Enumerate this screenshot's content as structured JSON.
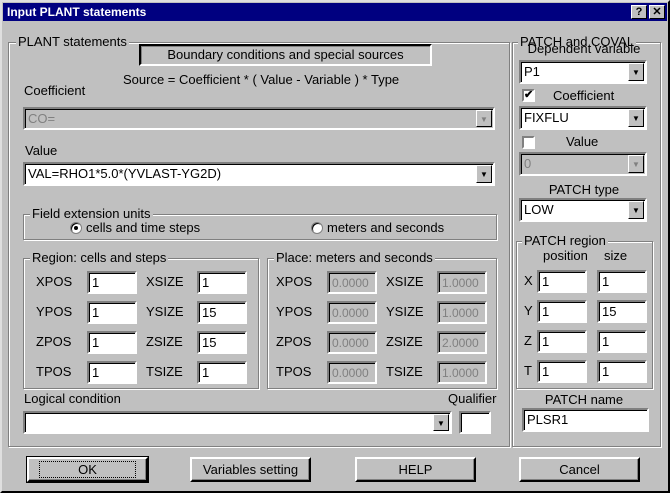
{
  "title": "Input PLANT statements",
  "title_buttons": {
    "help": "?",
    "close": "✕"
  },
  "plant": {
    "legend": "PLANT statements",
    "boundary_button": "Boundary conditions and special sources",
    "formula": "Source = Coefficient * ( Value -  Variable  ) * Type",
    "coefficient_label": "Coefficient",
    "coefficient_value": "CO=",
    "value_label": "Value",
    "value_value": "VAL=RHO1*5.0*(YVLAST-YG2D)",
    "field_ext": {
      "legend": "Field extension units",
      "options": [
        "cells and time steps",
        "meters and seconds"
      ],
      "selected": 0
    },
    "region": {
      "legend": "Region: cells and steps",
      "rows": [
        {
          "pos_label": "XPOS",
          "pos": "1",
          "size_label": "XSIZE",
          "size": "1"
        },
        {
          "pos_label": "YPOS",
          "pos": "1",
          "size_label": "YSIZE",
          "size": "15"
        },
        {
          "pos_label": "ZPOS",
          "pos": "1",
          "size_label": "ZSIZE",
          "size": "15"
        },
        {
          "pos_label": "TPOS",
          "pos": "1",
          "size_label": "TSIZE",
          "size": "1"
        }
      ]
    },
    "place": {
      "legend": "Place: meters and seconds",
      "rows": [
        {
          "pos_label": "XPOS",
          "pos": "0.0000",
          "size_label": "XSIZE",
          "size": "1.0000"
        },
        {
          "pos_label": "YPOS",
          "pos": "0.0000",
          "size_label": "YSIZE",
          "size": "1.0000"
        },
        {
          "pos_label": "ZPOS",
          "pos": "0.0000",
          "size_label": "ZSIZE",
          "size": "2.0000"
        },
        {
          "pos_label": "TPOS",
          "pos": "0.0000",
          "size_label": "TSIZE",
          "size": "1.0000"
        }
      ]
    },
    "logical_label": "Logical condition",
    "logical_value": "",
    "qualifier_label": "Qualifier",
    "qualifier_value": ""
  },
  "patch": {
    "legend": "PATCH and COVAL",
    "dep_var_label": "Dependent variable",
    "dep_var": "P1",
    "coefficient_label": "Coefficient",
    "coefficient_checked": true,
    "coefficient_value": "FIXFLU",
    "value_label": "Value",
    "value_checked": false,
    "value_value": "0",
    "type_label": "PATCH type",
    "type_value": "LOW",
    "region": {
      "legend": "PATCH region",
      "pos_header": "position",
      "size_header": "size",
      "rows": [
        {
          "label": "X",
          "pos": "1",
          "size": "1"
        },
        {
          "label": "Y",
          "pos": "1",
          "size": "15"
        },
        {
          "label": "Z",
          "pos": "1",
          "size": "1"
        },
        {
          "label": "T",
          "pos": "1",
          "size": "1"
        }
      ]
    },
    "name_label": "PATCH name",
    "name_value": "PLSR1"
  },
  "buttons": {
    "ok": "OK",
    "variables": "Variables setting",
    "help": "HELP",
    "cancel": "Cancel"
  }
}
